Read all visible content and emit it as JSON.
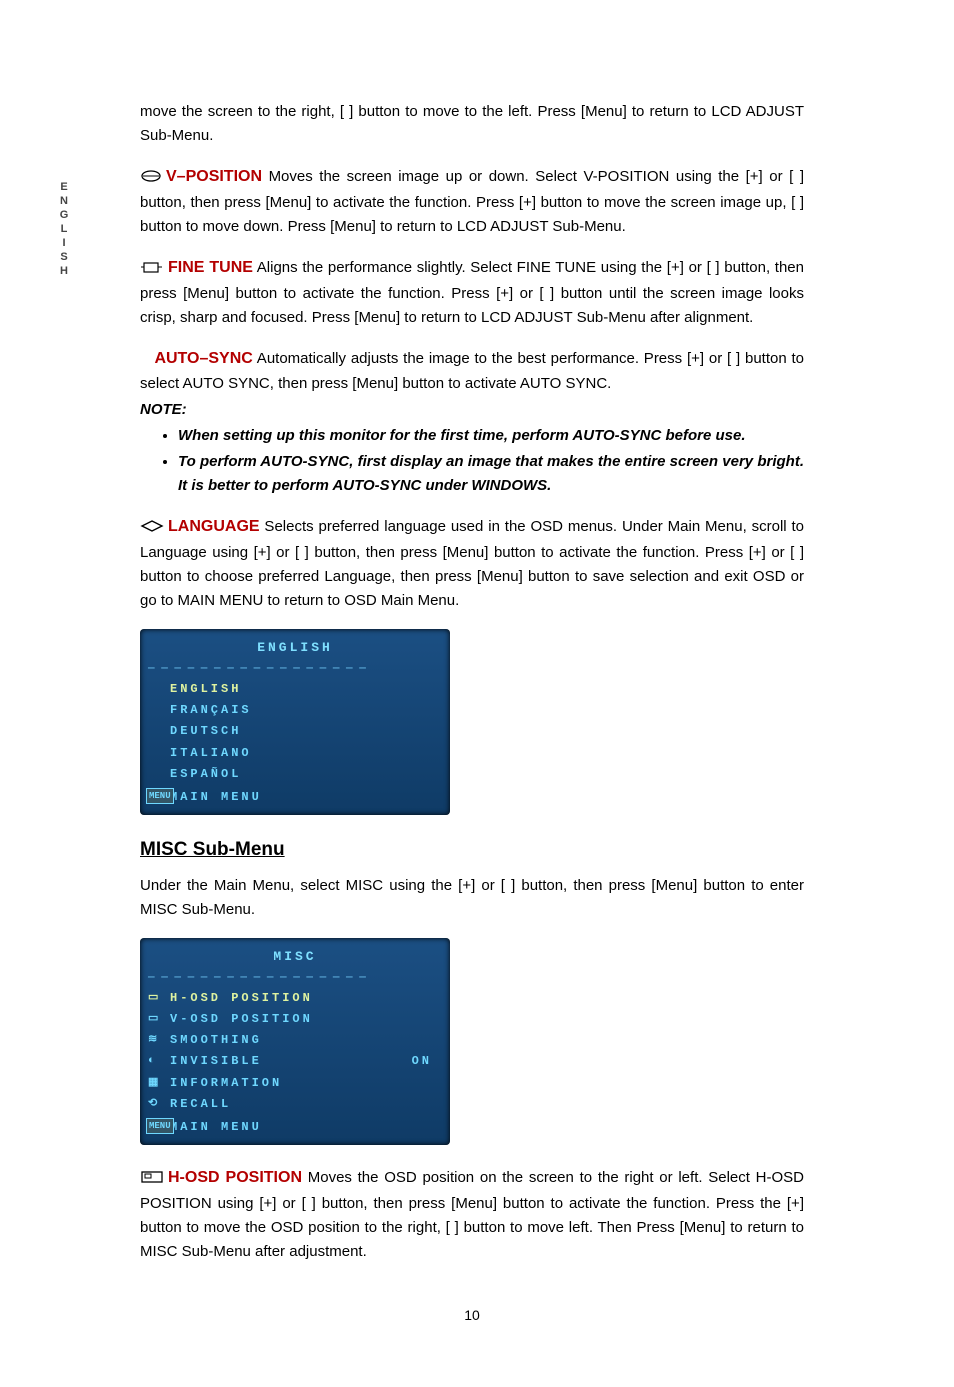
{
  "lang_tab": [
    "E",
    "N",
    "G",
    "L",
    "I",
    "S",
    "H"
  ],
  "intro_continued": "move the screen to the right, [ ] button to move to the left. Press [Menu] to return to LCD ADJUST Sub-Menu.",
  "vpos": {
    "title": "V–POSITION",
    "body": " Moves the screen image up or down. Select V-POSITION using the [+] or [ ] button, then press [Menu] to activate the function. Press [+] button to move the screen image up, [ ] button to move down. Press [Menu] to return to LCD ADJUST Sub-Menu."
  },
  "fine": {
    "title": "FINE TUNE",
    "body": " Aligns the performance slightly. Select FINE TUNE using the [+] or [ ] button, then press [Menu] button to activate the function. Press [+] or [ ] button until the screen image looks crisp, sharp and focused. Press [Menu] to return to LCD ADJUST Sub-Menu after alignment."
  },
  "autosync": {
    "title": "AUTO–SYNC",
    "body": " Automatically adjusts the image to the best performance. Press [+] or [ ] button to select AUTO SYNC, then press [Menu] button to activate AUTO SYNC.",
    "note_label": "NOTE:",
    "notes": [
      "When setting up this monitor for the first time, perform AUTO-SYNC before use.",
      "To perform AUTO-SYNC, first display an image that makes the entire screen very bright. It is better to perform AUTO-SYNC under WINDOWS."
    ]
  },
  "language": {
    "title": "LANGUAGE",
    "body": " Selects preferred language used in the OSD menus. Under Main Menu, scroll to Language using [+] or [ ] button, then press [Menu] button to activate the function. Press [+] or [ ] button to choose preferred Language, then press [Menu] button to save selection and exit OSD or go to MAIN MENU to return to OSD Main Menu."
  },
  "osd_lang": {
    "title": "ENGLISH",
    "items": [
      "ENGLISH",
      "FRANÇAIS",
      "DEUTSCH",
      "ITALIANO",
      "ESPAÑOL"
    ],
    "footer": "MAIN MENU",
    "footer_icon": "MENU"
  },
  "misc_heading": "MISC Sub-Menu",
  "misc_intro": "Under the Main Menu, select MISC using the [+] or [ ] button, then press [Menu] button to enter MISC Sub-Menu.",
  "osd_misc": {
    "title": "MISC",
    "items": [
      {
        "label": "H-OSD POSITION",
        "selected": true
      },
      {
        "label": "V-OSD POSITION"
      },
      {
        "label": "SMOOTHING"
      },
      {
        "label": "INVISIBLE",
        "value": "ON"
      },
      {
        "label": "INFORMATION"
      },
      {
        "label": "RECALL"
      }
    ],
    "footer": "MAIN MENU",
    "footer_icon": "MENU"
  },
  "hosd": {
    "title": "H-OSD POSITION",
    "body": " Moves the OSD position on the screen to the right or left. Select H-OSD POSITION using [+] or [ ] button, then press [Menu] button to activate the function. Press the [+] button to move the OSD position to the right, [ ] button to move left. Then Press [Menu] to return to MISC Sub-Menu after adjustment."
  },
  "page_number": "10",
  "chart_data": null
}
